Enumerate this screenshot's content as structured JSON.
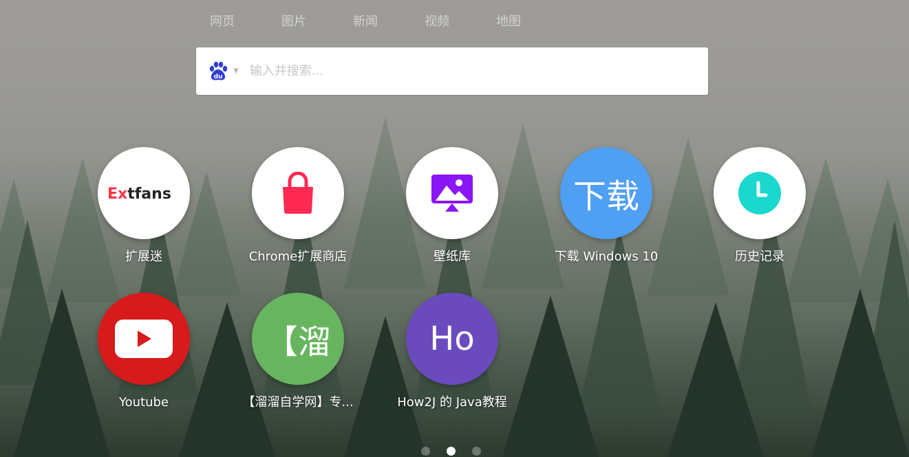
{
  "colors": {
    "background_fog": "#8e918c",
    "forest_dark": "#2a3a2e",
    "tile_white": "#ffffff",
    "extfans_red": "#f2384a",
    "extfans_dark": "#232323",
    "chrome_store_pink": "#ff2a52",
    "wallpaper_purple": "#8a16f5",
    "download_blue": "#4f9ff2",
    "history_teal": "#1ad8cd",
    "youtube_red": "#d71a1c",
    "liuliu_green": "#67b65f",
    "how2j_purple": "#6b4abd",
    "baidu_blue": "#2f3fd4"
  },
  "tabs": [
    {
      "label": "网页",
      "active": true
    },
    {
      "label": "图片",
      "active": false
    },
    {
      "label": "新闻",
      "active": false
    },
    {
      "label": "视频",
      "active": false
    },
    {
      "label": "地图",
      "active": false
    }
  ],
  "search": {
    "engine_icon": "baidu-paw-icon",
    "placeholder": "输入并搜索..."
  },
  "tiles": [
    {
      "label": "扩展迷",
      "icon": "extfans-logo",
      "logo_text_a": "Ex",
      "logo_text_b": "tfans"
    },
    {
      "label": "Chrome扩展商店",
      "icon": "shopping-bag-icon"
    },
    {
      "label": "壁纸库",
      "icon": "wallpaper-monitor-icon"
    },
    {
      "label": "下载 Windows 10",
      "icon": "text-tile",
      "icon_text": "下载"
    },
    {
      "label": "历史记录",
      "icon": "clock-icon"
    },
    {
      "label": "Youtube",
      "icon": "youtube-play-icon"
    },
    {
      "label": "【溜溜自学网】专...",
      "icon": "text-tile",
      "icon_text": "【溜"
    },
    {
      "label": "How2J 的 Java教程",
      "icon": "text-tile",
      "icon_text": "Ho"
    }
  ],
  "pagination": {
    "pages": 3,
    "active_page": 2
  }
}
